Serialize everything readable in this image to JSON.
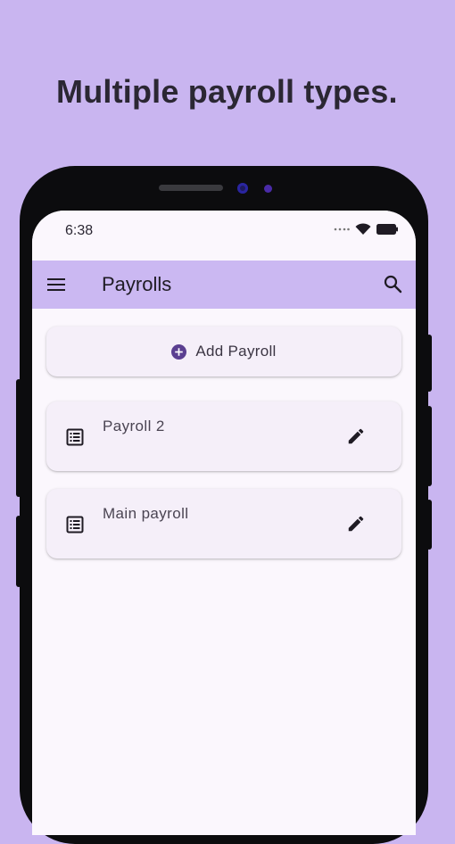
{
  "headline": "Multiple payroll types.",
  "status_bar": {
    "time": "6:38"
  },
  "app_bar": {
    "title": "Payrolls",
    "menu_icon": "hamburger-menu-icon",
    "search_icon": "search-icon"
  },
  "actions": {
    "add_payroll_label": "Add Payroll",
    "add_icon": "add-circle-icon"
  },
  "payrolls": [
    {
      "name": "Payroll 2",
      "icon": "list-alt-icon",
      "action_icon": "edit-pencil-icon"
    },
    {
      "name": "Main payroll",
      "icon": "list-alt-icon",
      "action_icon": "edit-pencil-icon"
    }
  ],
  "colors": {
    "background": "#c9b5f0",
    "app_bar": "#cbb8f2",
    "accent": "#5b3f91",
    "card": "#f5eff9"
  }
}
